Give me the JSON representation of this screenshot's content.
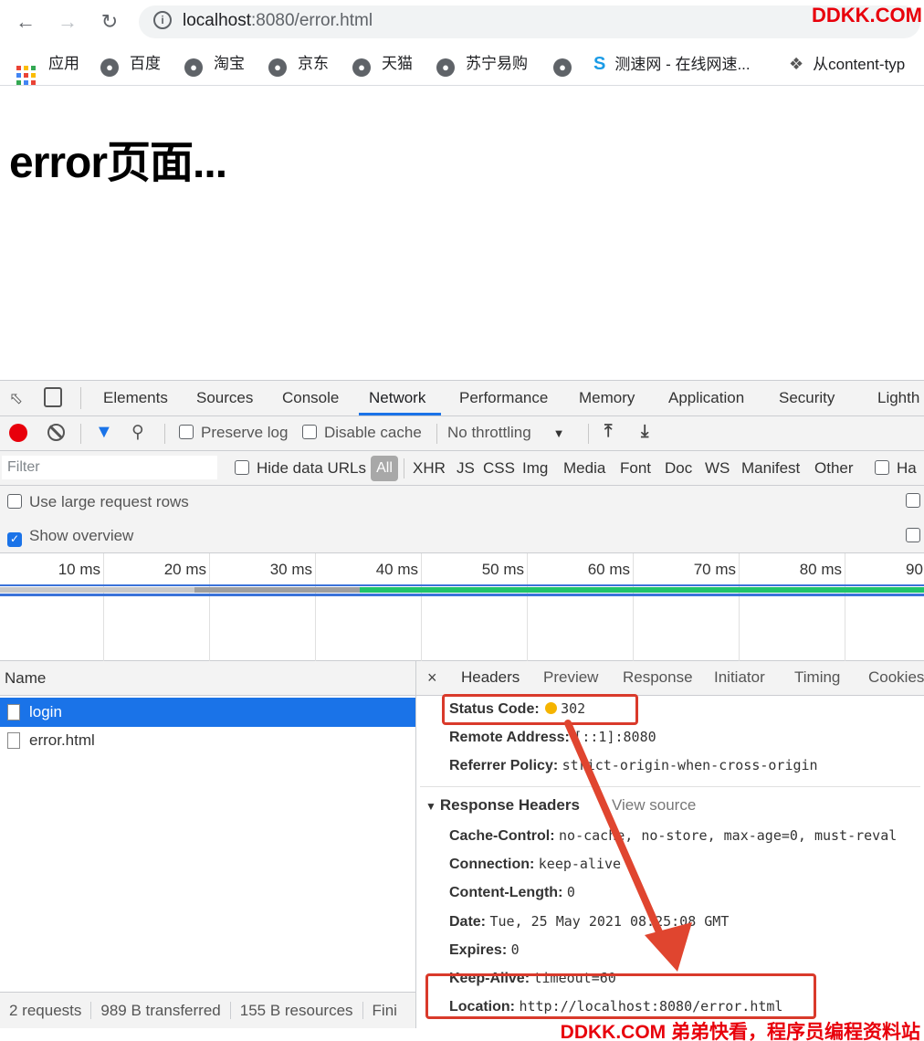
{
  "browser": {
    "back_icon": "arrow-left-icon",
    "forward_icon": "arrow-right-icon",
    "reload_icon": "reload-icon",
    "url_host": "localhost",
    "url_rest": ":8080/error.html",
    "site_info_icon": "info-icon"
  },
  "bookmarks": [
    {
      "label": "应用",
      "icon": "apps-grid-icon"
    },
    {
      "label": "百度",
      "icon": "globe-icon"
    },
    {
      "label": "淘宝",
      "icon": "globe-icon"
    },
    {
      "label": "京东",
      "icon": "globe-icon"
    },
    {
      "label": "天猫",
      "icon": "globe-icon"
    },
    {
      "label": "苏宁易购",
      "icon": "globe-icon"
    },
    {
      "label": "",
      "icon": "globe-icon"
    },
    {
      "label": "测速网 - 在线网速...",
      "icon": "speedtest-icon"
    },
    {
      "label": "从content-typ",
      "icon": "bookmark-icon"
    }
  ],
  "page": {
    "heading": "error页面..."
  },
  "devtools": {
    "tabs": [
      "Elements",
      "Sources",
      "Console",
      "Network",
      "Performance",
      "Memory",
      "Application",
      "Security",
      "Lighth"
    ],
    "active_tab": "Network",
    "toolbar": {
      "preserve_log": "Preserve log",
      "disable_cache": "Disable cache",
      "throttling": "No throttling"
    },
    "filter": {
      "placeholder": "Filter",
      "hide_data_urls": "Hide data URLs",
      "types": [
        "All",
        "XHR",
        "JS",
        "CSS",
        "Img",
        "Media",
        "Font",
        "Doc",
        "WS",
        "Manifest",
        "Other"
      ],
      "has_blocked_truncated": "Ha"
    },
    "options": {
      "large_rows": "Use large request rows",
      "show_overview": "Show overview"
    },
    "timeline_ticks": [
      "10 ms",
      "20 ms",
      "30 ms",
      "40 ms",
      "50 ms",
      "60 ms",
      "70 ms",
      "80 ms",
      "90"
    ],
    "list": {
      "header": "Name",
      "requests": [
        "login",
        "error.html"
      ],
      "selected": "login"
    },
    "status_bar": [
      "2 requests",
      "989 B transferred",
      "155 B resources",
      "Fini"
    ],
    "detail": {
      "close": "×",
      "tabs": [
        "Headers",
        "Preview",
        "Response",
        "Initiator",
        "Timing",
        "Cookies"
      ],
      "active_tab": "Headers",
      "general": [
        {
          "key": "Status Code:",
          "value": "302"
        },
        {
          "key": "Remote Address:",
          "value": "[::1]:8080"
        },
        {
          "key": "Referrer Policy:",
          "value": "strict-origin-when-cross-origin"
        }
      ],
      "response_headers_title": "Response Headers",
      "view_source": "View source",
      "response_headers": [
        {
          "key": "Cache-Control:",
          "value": "no-cache, no-store, max-age=0, must-reval"
        },
        {
          "key": "Connection:",
          "value": "keep-alive"
        },
        {
          "key": "Content-Length:",
          "value": "0"
        },
        {
          "key": "Date:",
          "value": "Tue, 25 May 2021 08:25:08 GMT"
        },
        {
          "key": "Expires:",
          "value": "0"
        },
        {
          "key": "Keep-Alive:",
          "value": "timeout=60"
        },
        {
          "key": "Location:",
          "value": "http://localhost:8080/error.html"
        }
      ]
    }
  },
  "watermark": {
    "top": "DDKK.COM",
    "bottom": "DDKK.COM 弟弟快看，程序员编程资料站"
  },
  "colors": {
    "accent": "#1a73e8",
    "annotation_red": "#d93a2b",
    "status_dot": "#f5b400",
    "record_red": "#e8000b"
  }
}
